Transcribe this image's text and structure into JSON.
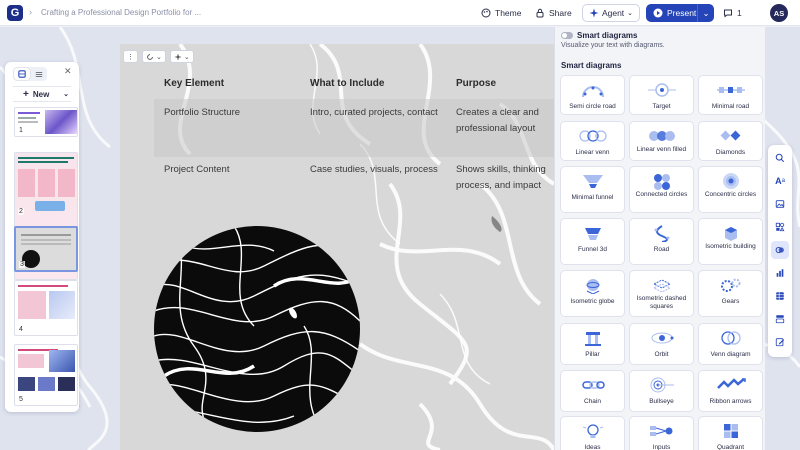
{
  "topbar": {
    "doc_title": "Crafting a Professional Design Portfolio for ...",
    "theme_label": "Theme",
    "share_label": "Share",
    "agent_label": "Agent",
    "present_label": "Present",
    "comment_count": "1",
    "avatar_initials": "AS",
    "logo_letter": "G"
  },
  "slide_panel": {
    "new_label": "New",
    "thumbnails": [
      "1",
      "2",
      "3",
      "4",
      "5"
    ],
    "selected": "3"
  },
  "slide": {
    "headers": [
      "Key Element",
      "What to Include",
      "Purpose"
    ],
    "rows": [
      {
        "col1": "Portfolio Structure",
        "col2": "Intro, curated projects, contact",
        "col3": "Creates a clear and professional layout"
      },
      {
        "col1": "Project Content",
        "col2": "Case studies, visuals, process",
        "col3": "Shows skills, thinking process, and impact"
      }
    ]
  },
  "smart_diagrams": {
    "toggle_label": "Smart diagrams",
    "subtitle": "Visualize your text with diagrams.",
    "section_title": "Smart diagrams",
    "items": [
      "Semi circle road",
      "Target",
      "Minimal road",
      "Linear venn",
      "Linear venn filled",
      "Diamonds",
      "Minimal funnel",
      "Connected circles",
      "Concentric circles",
      "Funnel 3d",
      "Road",
      "Isometric building",
      "Isometric globe",
      "Isometric dashed squares",
      "Gears",
      "Pillar",
      "Orbit",
      "Venn diagram",
      "Chain",
      "Bullseye",
      "Ribbon arrows",
      "Ideas",
      "Inputs",
      "Quadrant"
    ]
  },
  "colors": {
    "accent": "#2444b8",
    "diagram_blue": "#3b66d8",
    "panel_bg": "#f3f4f8"
  },
  "icons": {
    "rail": [
      "search-icon",
      "text-icon",
      "image-icon",
      "shapes-icon",
      "smart-diagram-icon",
      "chart-icon",
      "table-icon",
      "layout-icon",
      "edit-icon"
    ]
  }
}
